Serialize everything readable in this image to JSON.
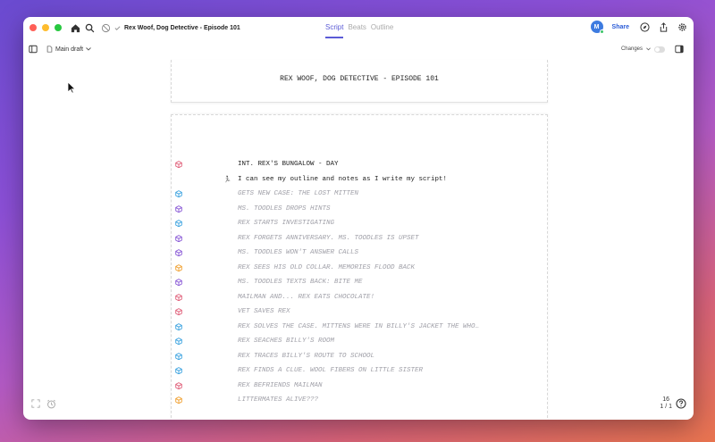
{
  "window": {
    "title": "Rex Woof, Dog Detective - Episode 101",
    "tabs": [
      {
        "label": "Script",
        "active": true
      },
      {
        "label": "Beats",
        "active": false
      },
      {
        "label": "Outline",
        "active": false
      }
    ],
    "avatar_initial": "M",
    "share_label": "Share"
  },
  "toolbar": {
    "draft_label": "Main draft",
    "changes_label": "Changes"
  },
  "script": {
    "title_page": "REX WOOF, DOG DETECTIVE - EPISODE 101",
    "lines": [
      {
        "type": "scene",
        "text": "INT. REX'S BUNGALOW - DAY",
        "marker_color": "#e0607a"
      },
      {
        "type": "action",
        "text": "I can see my outline and notes as I write my script!",
        "marker_color": ""
      },
      {
        "type": "beat",
        "text": "GETS NEW CASE: THE LOST MITTEN",
        "marker_color": "#3da3e0"
      },
      {
        "type": "beat",
        "text": "MS. TOODLES DROPS HINTS",
        "marker_color": "#8a5ad6"
      },
      {
        "type": "beat",
        "text": "REX STARTS INVESTIGATING",
        "marker_color": "#3da3e0"
      },
      {
        "type": "beat",
        "text": "REX FORGETS ANNIVERSARY. MS. TOODLES IS UPSET",
        "marker_color": "#8a5ad6"
      },
      {
        "type": "beat",
        "text": "MS. TOODLES WON'T ANSWER CALLS",
        "marker_color": "#8a5ad6"
      },
      {
        "type": "beat",
        "text": "REX SEES HIS OLD COLLAR. MEMORIES FLOOD BACK",
        "marker_color": "#f0a030"
      },
      {
        "type": "beat",
        "text": "MS. TOODLES TEXTS BACK: BITE ME",
        "marker_color": "#8a5ad6"
      },
      {
        "type": "beat",
        "text": "MAILMAN AND... REX EATS CHOCOLATE!",
        "marker_color": "#e0607a"
      },
      {
        "type": "beat",
        "text": "VET SAVES REX",
        "marker_color": "#e0607a"
      },
      {
        "type": "beat",
        "text": "REX SOLVES THE CASE. MITTENS WERE IN BILLY'S JACKET THE WHO…",
        "marker_color": "#3da3e0"
      },
      {
        "type": "beat",
        "text": "REX SEACHES BILLY'S ROOM",
        "marker_color": "#3da3e0"
      },
      {
        "type": "beat",
        "text": "REX TRACES BILLY'S ROUTE TO SCHOOL",
        "marker_color": "#3da3e0"
      },
      {
        "type": "beat",
        "text": "REX FINDS A CLUE. WOOL FIBERS ON LITTLE SISTER",
        "marker_color": "#3da3e0"
      },
      {
        "type": "beat",
        "text": "REX BEFRIENDS MAILMAN",
        "marker_color": "#e0607a"
      },
      {
        "type": "beat",
        "text": "LITTERMATES ALIVE???",
        "marker_color": "#f0a030"
      }
    ]
  },
  "status": {
    "page_number": "16",
    "page_of": "1 / 1"
  }
}
